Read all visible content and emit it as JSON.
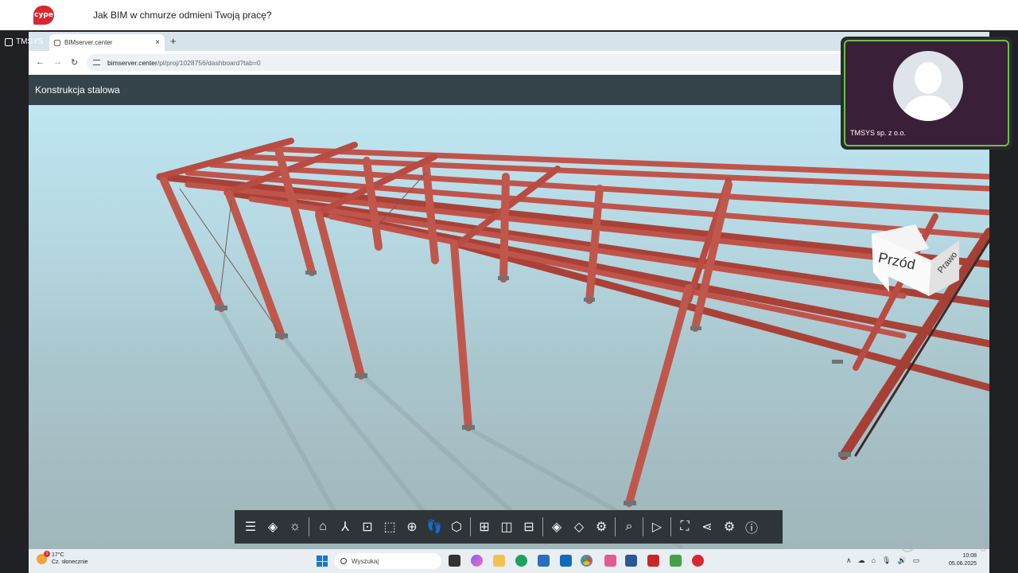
{
  "header": {
    "logo_text": "cype",
    "title": "Jak BIM w chmurze odmieni Twoją pracę?"
  },
  "presenter": {
    "label": "TMSYS"
  },
  "browser": {
    "tab_title": "BIMserver.center",
    "tab_close": "×",
    "new_tab": "+",
    "url_host": "bimserver.center",
    "url_path": "/pl/proj/1028756/dashboard?tab=0"
  },
  "app": {
    "project_title": "Konstrukcja stalowa"
  },
  "viewcube": {
    "front": "Przód",
    "right": "Prawo"
  },
  "toolbar": {
    "icons": [
      "menu-icon",
      "layers-icon",
      "light-icon",
      "home-icon",
      "axes-icon",
      "zoom-extents-icon",
      "zoom-window-icon",
      "orbit-icon",
      "walk-icon",
      "section-box-icon",
      "split-view-icon",
      "split-horizontal-icon",
      "split-vertical-icon",
      "layers-stack-icon",
      "layers-alt-icon",
      "layers-settings-icon",
      "search-icon",
      "play-icon",
      "fullscreen-icon",
      "share-icon",
      "settings-icon",
      "help-icon"
    ]
  },
  "webcam": {
    "name": "TMSYS sp. z o.o."
  },
  "taskbar": {
    "weather_temp": "17°C",
    "weather_desc": "Cz. słonecznie",
    "weather_badge": "1",
    "search_placeholder": "Wyszukaj",
    "time": "10:08",
    "date": "05.06.2025"
  },
  "watermark": "ClickMeeting",
  "colors": {
    "steel": "#c0544b",
    "app_header": "#34444a",
    "toolbar": "#2f3438",
    "cam_border": "#6cc04a"
  }
}
